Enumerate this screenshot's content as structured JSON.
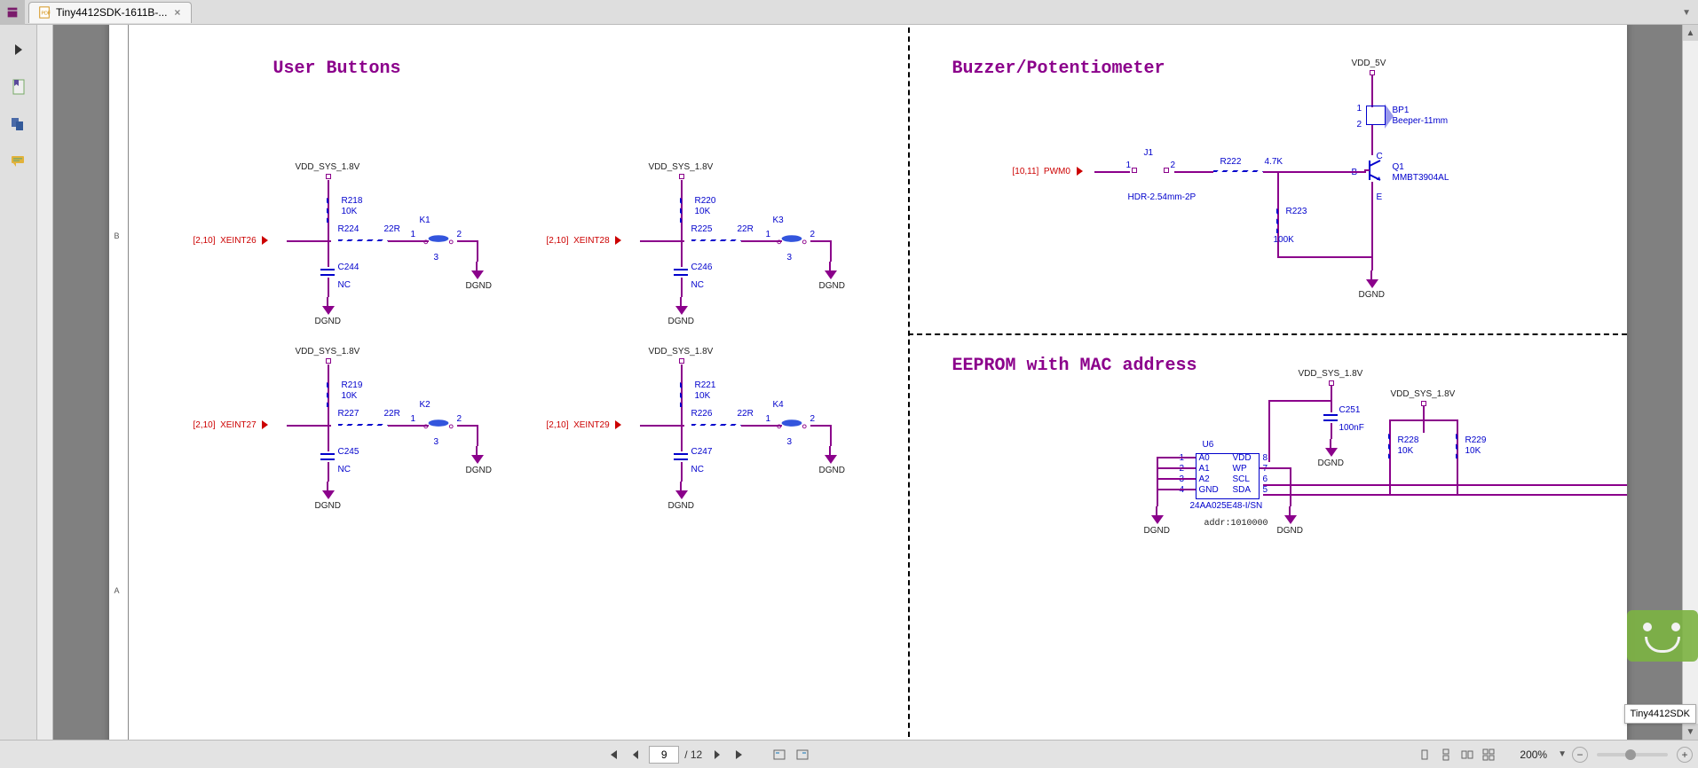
{
  "app": {
    "tab_title": "Tiny4412SDK-1611B-...",
    "watermark_label": "Tiny4412SDK"
  },
  "statusbar": {
    "page_input": "9",
    "page_total": "/ 12",
    "zoom_percent": "200%"
  },
  "schematic": {
    "sections": {
      "user_buttons": {
        "title": "User Buttons"
      },
      "buzzer_pot": {
        "title": "Buzzer/Potentiometer"
      },
      "eeprom": {
        "title": "EEPROM with MAC address"
      }
    },
    "power": {
      "vdd_sys_18": "VDD_SYS_1.8V",
      "vdd_5v": "VDD_5V",
      "dgnd": "DGND"
    },
    "offpage": {
      "xeint26": {
        "sheets": "[2,10]",
        "net": "XEINT26"
      },
      "xeint27": {
        "sheets": "[2,10]",
        "net": "XEINT27"
      },
      "xeint28": {
        "sheets": "[2,10]",
        "net": "XEINT28"
      },
      "xeint29": {
        "sheets": "[2,10]",
        "net": "XEINT29"
      },
      "pwm0": {
        "sheets": "[10,11]",
        "net": "PWM0"
      }
    },
    "components": {
      "R218": {
        "ref": "R218",
        "val": "10K"
      },
      "R219": {
        "ref": "R219",
        "val": "10K"
      },
      "R220": {
        "ref": "R220",
        "val": "10K"
      },
      "R221": {
        "ref": "R221",
        "val": "10K"
      },
      "R222": {
        "ref": "R222",
        "val": "4.7K"
      },
      "R223": {
        "ref": "R223",
        "val": "100K"
      },
      "R224": {
        "ref": "R224",
        "val": "22R"
      },
      "R225": {
        "ref": "R225",
        "val": "22R"
      },
      "R226": {
        "ref": "R226",
        "val": "22R"
      },
      "R227": {
        "ref": "R227",
        "val": "22R"
      },
      "R228": {
        "ref": "R228",
        "val": "10K"
      },
      "R229": {
        "ref": "R229",
        "val": "10K"
      },
      "C244": {
        "ref": "C244",
        "val": "NC"
      },
      "C245": {
        "ref": "C245",
        "val": "NC"
      },
      "C246": {
        "ref": "C246",
        "val": "NC"
      },
      "C247": {
        "ref": "C247",
        "val": "NC"
      },
      "C251": {
        "ref": "C251",
        "val": "100nF"
      },
      "K1": {
        "ref": "K1"
      },
      "K2": {
        "ref": "K2"
      },
      "K3": {
        "ref": "K3"
      },
      "K4": {
        "ref": "K4"
      },
      "J1": {
        "ref": "J1",
        "val": "HDR-2.54mm-2P"
      },
      "BP1": {
        "ref": "BP1",
        "val": "Beeper-11mm"
      },
      "Q1": {
        "ref": "Q1",
        "val": "MMBT3904AL",
        "pins": {
          "b": "B",
          "c": "C",
          "e": "E"
        }
      },
      "U6": {
        "ref": "U6",
        "part": "24AA025E48-I/SN",
        "addr_label": "addr:1010000",
        "pins": {
          "1": "A0",
          "2": "A1",
          "3": "A2",
          "4": "GND",
          "5": "SDA",
          "6": "SCL",
          "7": "WP",
          "8": "VDD"
        }
      }
    },
    "pinnums": {
      "p1": "1",
      "p2": "2",
      "p3": "3",
      "p4": "4",
      "p5": "5",
      "p6": "6",
      "p7": "7",
      "p8": "8"
    },
    "margin_labels": {
      "a": "A",
      "b": "B"
    }
  }
}
